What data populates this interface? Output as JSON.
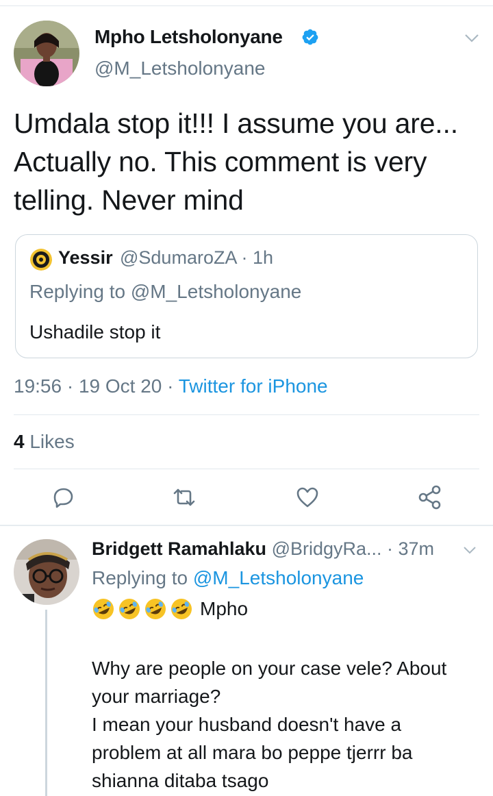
{
  "tweet": {
    "author_name": "Mpho Letsholonyane",
    "author_handle": "@M_Letsholonyane",
    "text": "Umdala stop it!!! I assume you are... Actually no. This comment is very telling. Never mind",
    "timestamp": "19:56 · 19 Oct 20 · ",
    "source": "Twitter for iPhone",
    "likes_count": "4",
    "likes_label": " Likes"
  },
  "quote": {
    "name": "Yessir",
    "handle_time": "@SdumaroZA · 1h",
    "replying_to": "Replying to @M_Letsholonyane",
    "text": "Ushadile stop it"
  },
  "reply": {
    "name": "Bridgett Ramahlaku",
    "handle_time": " @BridgyRa... · 37m",
    "replying_prefix": "Replying to ",
    "replying_mention": "@M_Letsholonyane",
    "emoji_text": "Mpho",
    "body_lines": [
      "Why are people on your case vele? About",
      "your marriage?",
      "I mean your husband doesn't have a",
      "problem at all mara bo peppe tjerrr ba",
      "shianna ditaba tsago"
    ]
  },
  "icons": {
    "verified": "verified-badge-icon",
    "caret": "chevron-down-icon",
    "reply": "reply-icon",
    "retweet": "retweet-icon",
    "like": "heart-icon",
    "share": "share-icon",
    "emoji": "rolling-on-floor-laughing-emoji"
  },
  "colors": {
    "accent": "#1b95e0",
    "secondary_text": "#657786",
    "divider": "#e1e8ed"
  }
}
